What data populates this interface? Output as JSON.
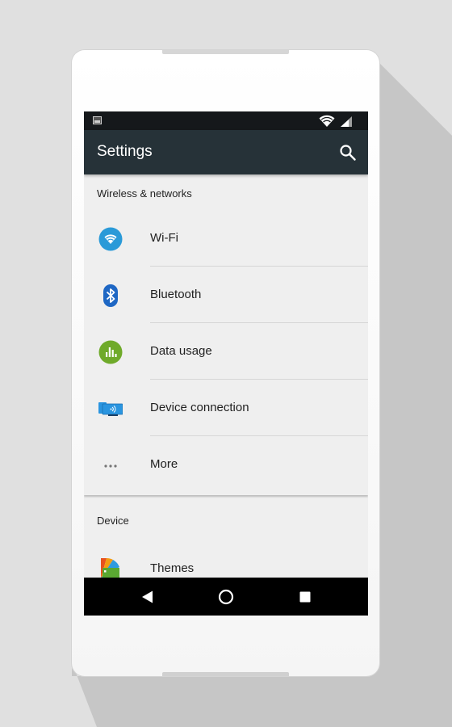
{
  "status_bar": {
    "left_icon": "gallery-notification-icon",
    "right_icons": [
      "wifi-signal-icon",
      "cellular-signal-icon"
    ]
  },
  "app_bar": {
    "title": "Settings",
    "action_icon": "search-icon",
    "background_color": "#263238"
  },
  "sections": [
    {
      "header": "Wireless & networks",
      "items": [
        {
          "label": "Wi-Fi",
          "icon": "wifi-icon",
          "color": "#2a9ad8"
        },
        {
          "label": "Bluetooth",
          "icon": "bluetooth-icon",
          "color": "#1e67c4"
        },
        {
          "label": "Data usage",
          "icon": "data-usage-icon",
          "color": "#6faa2a"
        },
        {
          "label": "Device connection",
          "icon": "device-connection-icon",
          "color": "#2a95e0"
        },
        {
          "label": "More",
          "icon": "more-dots-icon",
          "color": "#757575"
        }
      ]
    },
    {
      "header": "Device",
      "items": [
        {
          "label": "Themes",
          "icon": "themes-icon",
          "color": "#5aa832"
        }
      ]
    }
  ],
  "nav_bar": {
    "buttons": [
      "back-icon",
      "home-icon",
      "recents-icon"
    ]
  }
}
